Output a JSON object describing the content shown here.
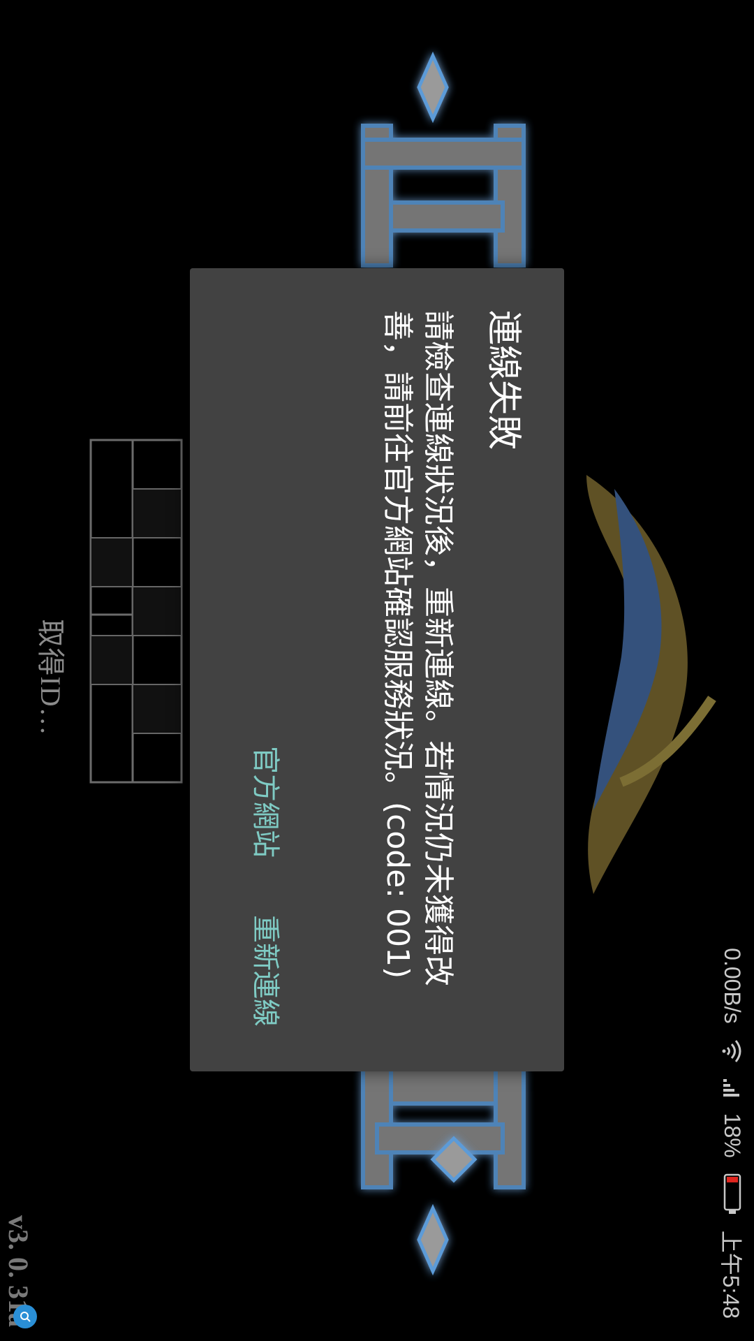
{
  "status_bar": {
    "time": "上午5:48",
    "battery_percent": "18%",
    "battery_level": 0.18,
    "network_speed": "0.00B/s"
  },
  "background": {
    "loading_text": "取得ID…",
    "version": "v3. 0. 31a"
  },
  "dialog": {
    "title": "連線失敗",
    "message": "請檢查連線狀況後，重新連線。若情況仍未獲得改善，請前往官方網站確認服務狀況。(code: 001)",
    "buttons": {
      "official_site": "官方網站",
      "reconnect": "重新連線"
    },
    "button_color": "#7fcbc4",
    "background_color": "#424242"
  }
}
